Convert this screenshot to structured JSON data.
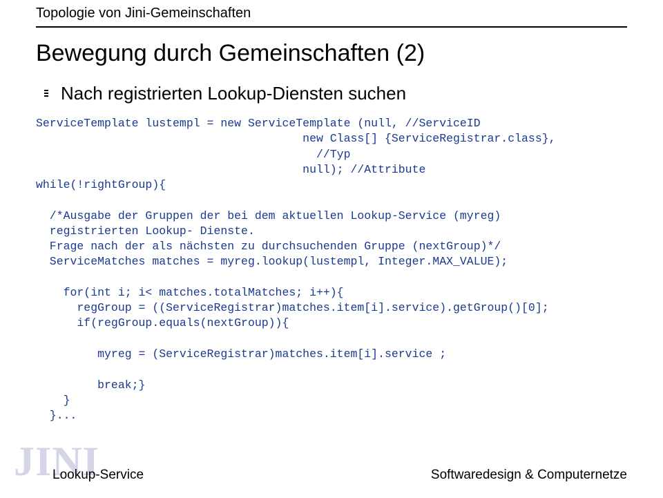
{
  "header": "Topologie von Jini-Gemeinschaften",
  "title": "Bewegung durch Gemeinschaften (2)",
  "bullet": "Nach registrierten Lookup-Diensten suchen",
  "code": {
    "l01": "ServiceTemplate lustempl = new ServiceTemplate (null, //ServiceID",
    "l02": "                                       new Class[] {ServiceRegistrar.class},",
    "l03": "                                         //Typ",
    "l04": "                                       null); //Attribute",
    "l05": "while(!rightGroup){",
    "l06": "",
    "l07": "  /*Ausgabe der Gruppen der bei dem aktuellen Lookup-Service (myreg)",
    "l08": "  registrierten Lookup- Dienste.",
    "l09": "  Frage nach der als nächsten zu durchsuchenden Gruppe (nextGroup)*/",
    "l10": "  ServiceMatches matches = myreg.lookup(lustempl, Integer.MAX_VALUE);",
    "l11": "",
    "l12": "    for(int i; i< matches.totalMatches; i++){",
    "l13": "      regGroup = ((ServiceRegistrar)matches.item[i].service).getGroup()[0];",
    "l14": "      if(regGroup.equals(nextGroup)){",
    "l15": "",
    "l16": "         myreg = (ServiceRegistrar)matches.item[i].service ;",
    "l17": "",
    "l18": "         break;}",
    "l19": "    }",
    "l20": "  }...",
    "l21": ""
  },
  "watermark": "JINI",
  "footer_left": "Lookup-Service",
  "footer_right": "Softwaredesign & Computernetze"
}
